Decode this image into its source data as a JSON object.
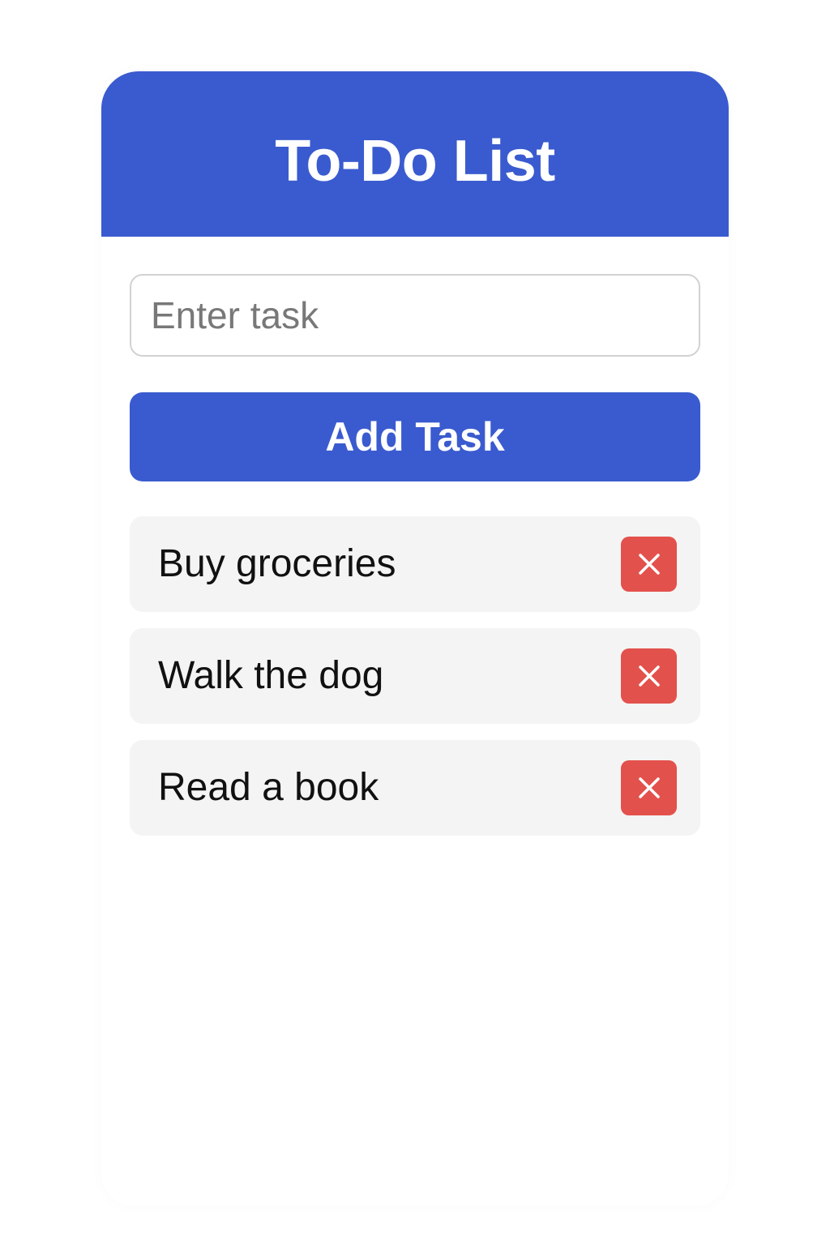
{
  "app": {
    "title": "To-Do List"
  },
  "input": {
    "placeholder": "Enter task",
    "value": ""
  },
  "add_button": {
    "label": "Add Task"
  },
  "tasks": [
    {
      "text": "Buy groceries",
      "delete_icon": "close-icon"
    },
    {
      "text": "Walk the dog",
      "delete_icon": "close-icon"
    },
    {
      "text": "Read a book",
      "delete_icon": "close-icon"
    }
  ],
  "colors": {
    "primary": "#3a5bcf",
    "danger": "#e3514c",
    "task_background": "#f4f4f4",
    "input_border": "#d2d2d2"
  }
}
